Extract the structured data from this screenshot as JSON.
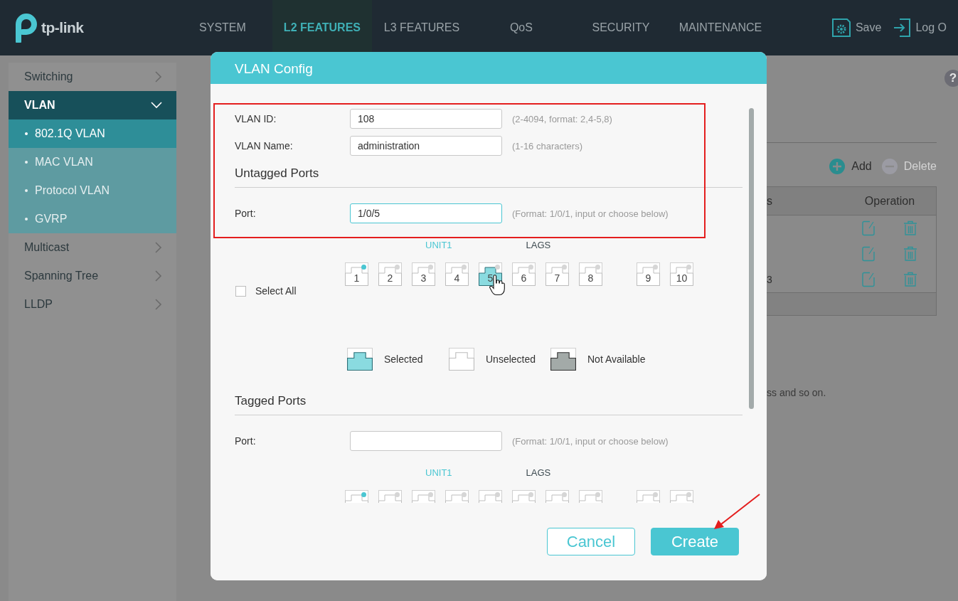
{
  "top_bar": {
    "logo_text": "tp-link",
    "nav": [
      {
        "label": "SYSTEM",
        "selected": false
      },
      {
        "label": "L2 FEATURES",
        "selected": true
      },
      {
        "label": "L3 FEATURES",
        "selected": false
      },
      {
        "label": "QoS",
        "selected": false
      },
      {
        "label": "SECURITY",
        "selected": false
      },
      {
        "label": "MAINTENANCE",
        "selected": false
      }
    ],
    "actions": [
      {
        "kind": "save",
        "label": "Save"
      },
      {
        "kind": "logout",
        "label": "Log O"
      }
    ]
  },
  "sidebar": {
    "items": [
      {
        "label": "Switching",
        "expanded": false
      },
      {
        "label": "VLAN",
        "expanded": true,
        "children": [
          {
            "label": "802.1Q VLAN",
            "selected": true
          },
          {
            "label": "MAC VLAN",
            "selected": false
          },
          {
            "label": "Protocol VLAN",
            "selected": false
          },
          {
            "label": "GVRP",
            "selected": false
          }
        ]
      },
      {
        "label": "Multicast",
        "expanded": false
      },
      {
        "label": "Spanning Tree",
        "expanded": false
      },
      {
        "label": "LLDP",
        "expanded": false
      }
    ]
  },
  "main": {
    "help": "?",
    "toolbar": [
      {
        "kind": "add",
        "label": "Add",
        "disabled": false
      },
      {
        "kind": "delete",
        "label": "Delete",
        "disabled": true
      }
    ],
    "table": {
      "columns": [
        "s",
        "Operation"
      ],
      "rows": [
        {
          "kind": "entry"
        },
        {
          "kind": "entry"
        },
        {
          "kind": "entry",
          "column_1": "3"
        }
      ]
    },
    "note": "ss and so on."
  },
  "dialog": {
    "title": "VLAN Config",
    "fields": [
      {
        "label": "VLAN ID:",
        "value": "108",
        "hint": "(2-4094, format: 2,4-5,8)",
        "focused": false
      },
      {
        "label": "VLAN Name:",
        "value": "administration",
        "hint": "(1-16 characters)",
        "focused": false
      }
    ],
    "sections": [
      {
        "heading": "Untagged Ports",
        "port_field": {
          "label": "Port:",
          "value": "1/0/5",
          "hint": "(Format: 1/0/1, input or choose below)",
          "focused": true
        },
        "select_all": {
          "label": "Select All",
          "checked": false
        },
        "unit_tabs": [
          {
            "label": "UNIT1",
            "selected": true
          },
          {
            "label": "LAGS",
            "selected": false
          }
        ],
        "ports": [
          {
            "kind": "port",
            "label": "1",
            "selected": false,
            "link_up": true
          },
          {
            "kind": "port",
            "label": "2",
            "selected": false,
            "link_up": false
          },
          {
            "kind": "port",
            "label": "3",
            "selected": false,
            "link_up": false
          },
          {
            "kind": "port",
            "label": "4",
            "selected": false,
            "link_up": false
          },
          {
            "kind": "port",
            "label": "5",
            "selected": true,
            "link_up": false
          },
          {
            "kind": "port",
            "label": "6",
            "selected": false,
            "link_up": false
          },
          {
            "kind": "port",
            "label": "7",
            "selected": false,
            "link_up": false
          },
          {
            "kind": "port",
            "label": "8",
            "selected": false,
            "link_up": false
          },
          {
            "kind": "lag",
            "label": "9",
            "selected": false,
            "link_up": false
          },
          {
            "kind": "lag",
            "label": "10",
            "selected": false,
            "link_up": false
          }
        ],
        "legend": [
          {
            "kind": "selected",
            "label": "Selected"
          },
          {
            "kind": "unselected",
            "label": "Unselected"
          },
          {
            "kind": "unavailable",
            "label": "Not Available"
          }
        ]
      },
      {
        "heading": "Tagged Ports",
        "port_field": {
          "label": "Port:",
          "hint": "(Format: 1/0/1, input or choose below)",
          "focused": false
        },
        "unit_tabs": [
          {
            "label": "UNIT1",
            "selected": true
          },
          {
            "label": "LAGS",
            "selected": false
          }
        ],
        "ports": [
          {
            "kind": "port",
            "selected": false,
            "link_up": true
          },
          {
            "kind": "port",
            "selected": false,
            "link_up": false
          },
          {
            "kind": "port",
            "selected": false,
            "link_up": false
          },
          {
            "kind": "port",
            "selected": false,
            "link_up": false
          },
          {
            "kind": "port",
            "selected": false,
            "link_up": false
          },
          {
            "kind": "port",
            "selected": false,
            "link_up": false
          },
          {
            "kind": "port",
            "selected": false,
            "link_up": false
          },
          {
            "kind": "port",
            "selected": false,
            "link_up": false
          },
          {
            "kind": "lag",
            "selected": false,
            "link_up": false
          },
          {
            "kind": "lag",
            "selected": false,
            "link_up": false
          }
        ]
      }
    ],
    "buttons": [
      {
        "kind": "secondary",
        "label": "Cancel"
      },
      {
        "kind": "primary",
        "label": "Create"
      }
    ]
  }
}
